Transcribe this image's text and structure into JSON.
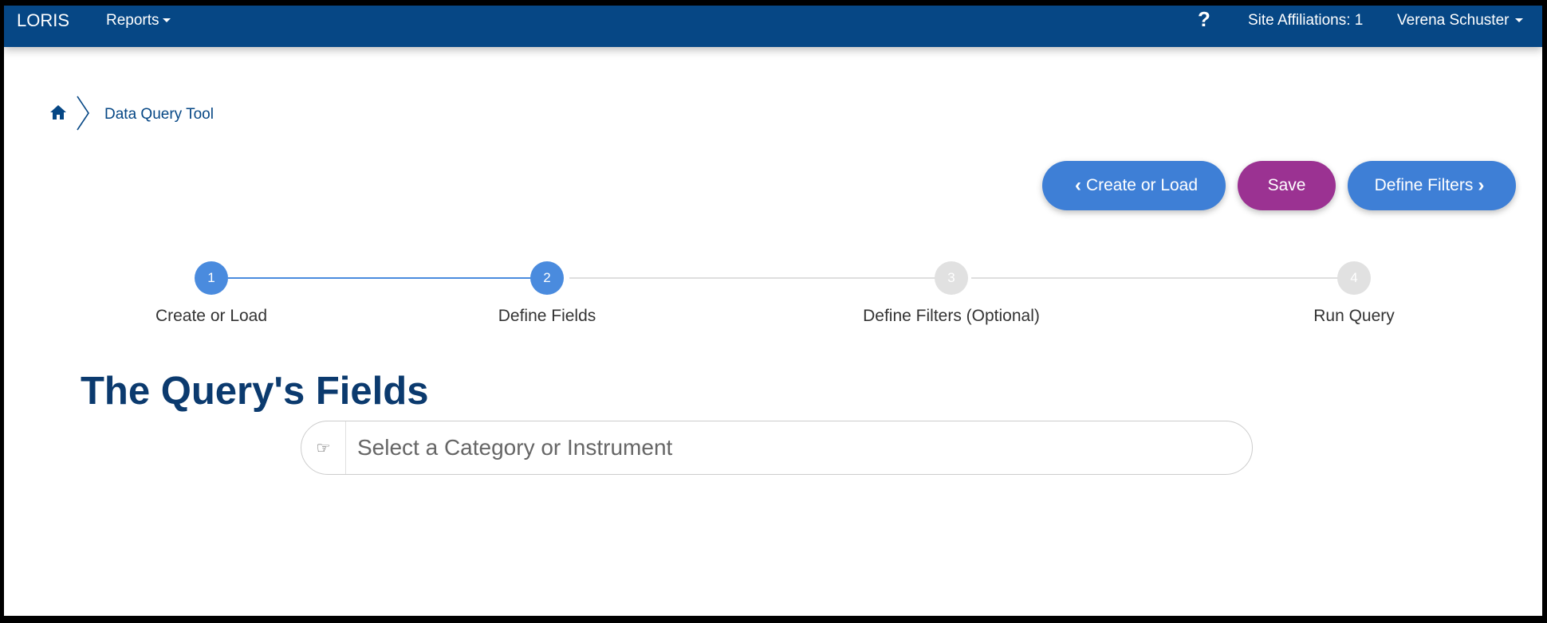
{
  "nav": {
    "brand": "LORIS",
    "reports_label": "Reports",
    "help_label": "?",
    "site_affiliations": "Site Affiliations: 1",
    "user_name": "Verena Schuster"
  },
  "breadcrumb": {
    "home_icon": "home-icon",
    "current": "Data Query Tool"
  },
  "actions": {
    "back_label": "Create or Load",
    "save_label": "Save",
    "next_label": "Define Filters"
  },
  "steps": [
    {
      "number": "1",
      "label": "Create or Load",
      "state": "complete"
    },
    {
      "number": "2",
      "label": "Define Fields",
      "state": "current"
    },
    {
      "number": "3",
      "label": "Define Filters (Optional)",
      "state": "pending"
    },
    {
      "number": "4",
      "label": "Run Query",
      "state": "pending"
    }
  ],
  "main": {
    "heading": "The Query's Fields",
    "select_placeholder": "Select a Category or Instrument",
    "select_icon": "hand-pointer-icon"
  },
  "colors": {
    "navbar": "#064785",
    "primary_button": "#3e7fd6",
    "save_button": "#9b3292",
    "step_active": "#4a8bde",
    "step_inactive": "#e1e1e1",
    "heading": "#0b3a6e"
  }
}
